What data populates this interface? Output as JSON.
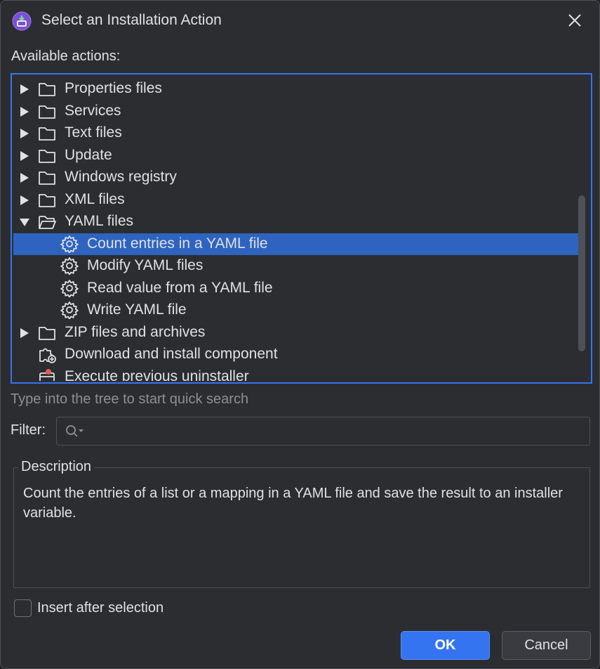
{
  "window": {
    "title": "Select an Installation Action",
    "app_icon": "installer-app-icon",
    "close_icon": "close-icon"
  },
  "tree": {
    "label": "Available actions:",
    "items": [
      {
        "label": "Properties files",
        "kind": "folder",
        "expanded": false
      },
      {
        "label": "Services",
        "kind": "folder",
        "expanded": false
      },
      {
        "label": "Text files",
        "kind": "folder",
        "expanded": false
      },
      {
        "label": "Update",
        "kind": "folder",
        "expanded": false
      },
      {
        "label": "Windows registry",
        "kind": "folder",
        "expanded": false
      },
      {
        "label": "XML files",
        "kind": "folder",
        "expanded": false
      },
      {
        "label": "YAML files",
        "kind": "folder-open",
        "expanded": true
      },
      {
        "label": "Count entries in a YAML file",
        "kind": "action",
        "selected": true
      },
      {
        "label": "Modify YAML files",
        "kind": "action"
      },
      {
        "label": "Read value from a YAML file",
        "kind": "action"
      },
      {
        "label": "Write YAML file",
        "kind": "action"
      },
      {
        "label": "ZIP files and archives",
        "kind": "folder",
        "expanded": false
      },
      {
        "label": "Download and install component",
        "kind": "component-action"
      },
      {
        "label": "Execute previous uninstaller",
        "kind": "uninstaller-action"
      }
    ]
  },
  "hint": "Type into the tree to start quick search",
  "filter": {
    "label": "Filter:",
    "value": "",
    "icon": "search-dropdown-icon"
  },
  "description": {
    "title": "Description",
    "text": "Count the entries of a list or a mapping in a YAML file and save the result to an installer variable."
  },
  "insert_after_selection": {
    "label": "Insert after selection",
    "checked": false
  },
  "buttons": {
    "ok": "OK",
    "cancel": "Cancel"
  },
  "colors": {
    "background": "#2b2d30",
    "accent": "#3574f0",
    "selection": "#2e64c0",
    "text": "#dfe1e5",
    "muted_text": "#8c8f94"
  }
}
